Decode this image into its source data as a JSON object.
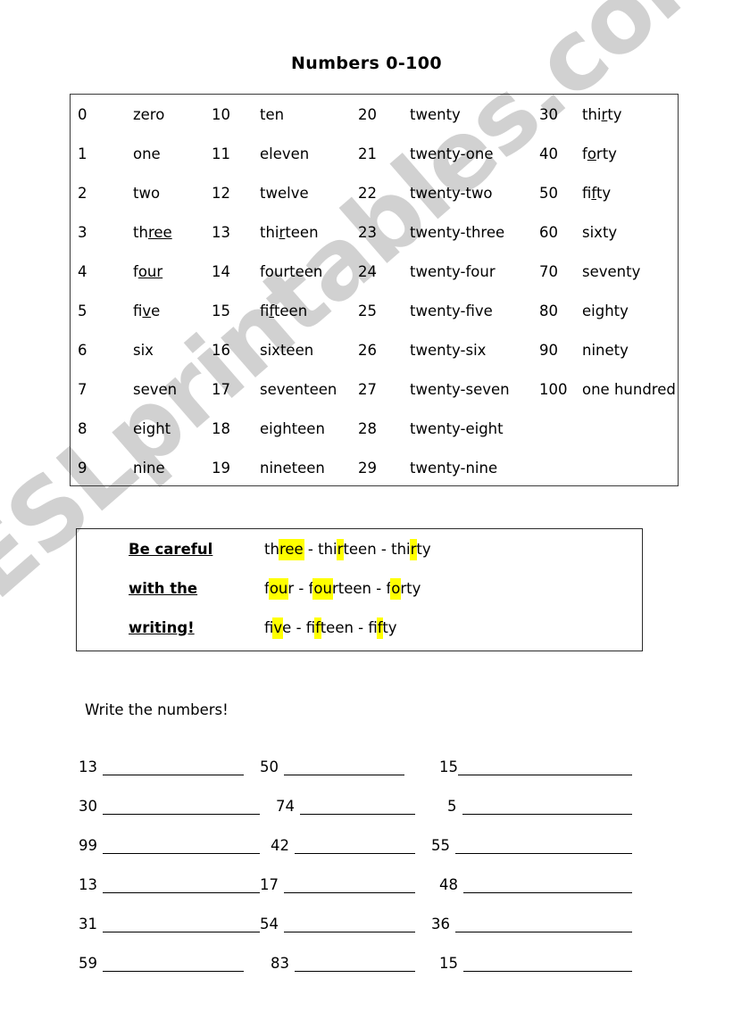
{
  "title": "Numbers 0-100",
  "watermark": "ESLprintables.com",
  "numbers_table": {
    "rows": [
      {
        "g1n": "0",
        "g1w": [
          {
            "t": "zero"
          }
        ],
        "g2n": "10",
        "g2w": [
          {
            "t": "ten"
          }
        ],
        "g3n": "20",
        "g3w": [
          {
            "t": "twenty"
          }
        ],
        "g4n": "30",
        "g4w": [
          {
            "t": "thi"
          },
          {
            "t": "r",
            "u": true
          },
          {
            "t": "ty"
          }
        ]
      },
      {
        "g1n": "1",
        "g1w": [
          {
            "t": "one"
          }
        ],
        "g2n": "11",
        "g2w": [
          {
            "t": "eleven"
          }
        ],
        "g3n": "21",
        "g3w": [
          {
            "t": "twenty-one"
          }
        ],
        "g4n": "40",
        "g4w": [
          {
            "t": "f"
          },
          {
            "t": "o",
            "u": true
          },
          {
            "t": "rty"
          }
        ]
      },
      {
        "g1n": "2",
        "g1w": [
          {
            "t": "two"
          }
        ],
        "g2n": "12",
        "g2w": [
          {
            "t": "twelve"
          }
        ],
        "g3n": "22",
        "g3w": [
          {
            "t": "twenty-two"
          }
        ],
        "g4n": "50",
        "g4w": [
          {
            "t": "fi"
          },
          {
            "t": "f",
            "u": true
          },
          {
            "t": "ty"
          }
        ]
      },
      {
        "g1n": "3",
        "g1w": [
          {
            "t": "th"
          },
          {
            "t": "ree",
            "u": true
          }
        ],
        "g2n": "13",
        "g2w": [
          {
            "t": "thi"
          },
          {
            "t": "r",
            "u": true
          },
          {
            "t": "teen"
          }
        ],
        "g3n": "23",
        "g3w": [
          {
            "t": "twenty-three"
          }
        ],
        "g4n": "60",
        "g4w": [
          {
            "t": "sixty"
          }
        ]
      },
      {
        "g1n": "4",
        "g1w": [
          {
            "t": "f"
          },
          {
            "t": "our",
            "u": true
          }
        ],
        "g2n": "14",
        "g2w": [
          {
            "t": "fourteen"
          }
        ],
        "g3n": "24",
        "g3w": [
          {
            "t": "twenty-four"
          }
        ],
        "g4n": "70",
        "g4w": [
          {
            "t": "seventy"
          }
        ]
      },
      {
        "g1n": "5",
        "g1w": [
          {
            "t": "fi"
          },
          {
            "t": "v",
            "u": true
          },
          {
            "t": "e"
          }
        ],
        "g2n": "15",
        "g2w": [
          {
            "t": "fi"
          },
          {
            "t": "f",
            "u": true
          },
          {
            "t": "teen"
          }
        ],
        "g3n": "25",
        "g3w": [
          {
            "t": "twenty-five"
          }
        ],
        "g4n": "80",
        "g4w": [
          {
            "t": "eighty"
          }
        ]
      },
      {
        "g1n": "6",
        "g1w": [
          {
            "t": "six"
          }
        ],
        "g2n": "16",
        "g2w": [
          {
            "t": "sixteen"
          }
        ],
        "g3n": "26",
        "g3w": [
          {
            "t": "twenty-six"
          }
        ],
        "g4n": "90",
        "g4w": [
          {
            "t": "ninety"
          }
        ]
      },
      {
        "g1n": "7",
        "g1w": [
          {
            "t": "seven"
          }
        ],
        "g2n": "17",
        "g2w": [
          {
            "t": "seventeen"
          }
        ],
        "g3n": "27",
        "g3w": [
          {
            "t": "twenty-seven"
          }
        ],
        "g4n": "100",
        "g4w": [
          {
            "t": "one hundred"
          }
        ]
      },
      {
        "g1n": "8",
        "g1w": [
          {
            "t": "eight"
          }
        ],
        "g2n": "18",
        "g2w": [
          {
            "t": "eighteen"
          }
        ],
        "g3n": "28",
        "g3w": [
          {
            "t": "twenty-eight"
          }
        ],
        "g4n": "",
        "g4w": []
      },
      {
        "g1n": "9",
        "g1w": [
          {
            "t": "nine"
          }
        ],
        "g2n": "19",
        "g2w": [
          {
            "t": "nineteen"
          }
        ],
        "g3n": "29",
        "g3w": [
          {
            "t": "twenty-nine"
          }
        ],
        "g4n": "",
        "g4w": []
      }
    ]
  },
  "careful_box": {
    "rows": [
      {
        "label": "Be careful",
        "text": [
          {
            "t": "th"
          },
          {
            "t": "ree",
            "h": true
          },
          {
            "t": " - thi"
          },
          {
            "t": "r",
            "h": true
          },
          {
            "t": "teen - thi"
          },
          {
            "t": "r",
            "h": true
          },
          {
            "t": "ty"
          }
        ]
      },
      {
        "label": "with the",
        "text": [
          {
            "t": "f"
          },
          {
            "t": "ou",
            "h": true
          },
          {
            "t": "r - f"
          },
          {
            "t": "ou",
            "h": true
          },
          {
            "t": "rteen - f"
          },
          {
            "t": "o",
            "h": true
          },
          {
            "t": "rty"
          }
        ]
      },
      {
        "label": "writing!",
        "text": [
          {
            "t": "fi"
          },
          {
            "t": "v",
            "h": true
          },
          {
            "t": "e - fi"
          },
          {
            "t": "f",
            "h": true
          },
          {
            "t": "teen - fi"
          },
          {
            "t": "f",
            "h": true
          },
          {
            "t": "ty"
          }
        ]
      }
    ],
    "highlight_color": "#ffff00"
  },
  "exercise": {
    "heading": "Write the numbers!",
    "rows": [
      [
        {
          "n": "13"
        },
        {
          "n": "50"
        },
        {
          "n": "15"
        }
      ],
      [
        {
          "n": "30"
        },
        {
          "n": "74"
        },
        {
          "n": "5"
        }
      ],
      [
        {
          "n": "99"
        },
        {
          "n": "42"
        },
        {
          "n": "55"
        }
      ],
      [
        {
          "n": "13"
        },
        {
          "n": "17"
        },
        {
          "n": "48"
        }
      ],
      [
        {
          "n": "31"
        },
        {
          "n": "54"
        },
        {
          "n": "36"
        }
      ],
      [
        {
          "n": "59"
        },
        {
          "n": "83"
        },
        {
          "n": "15"
        }
      ]
    ]
  }
}
